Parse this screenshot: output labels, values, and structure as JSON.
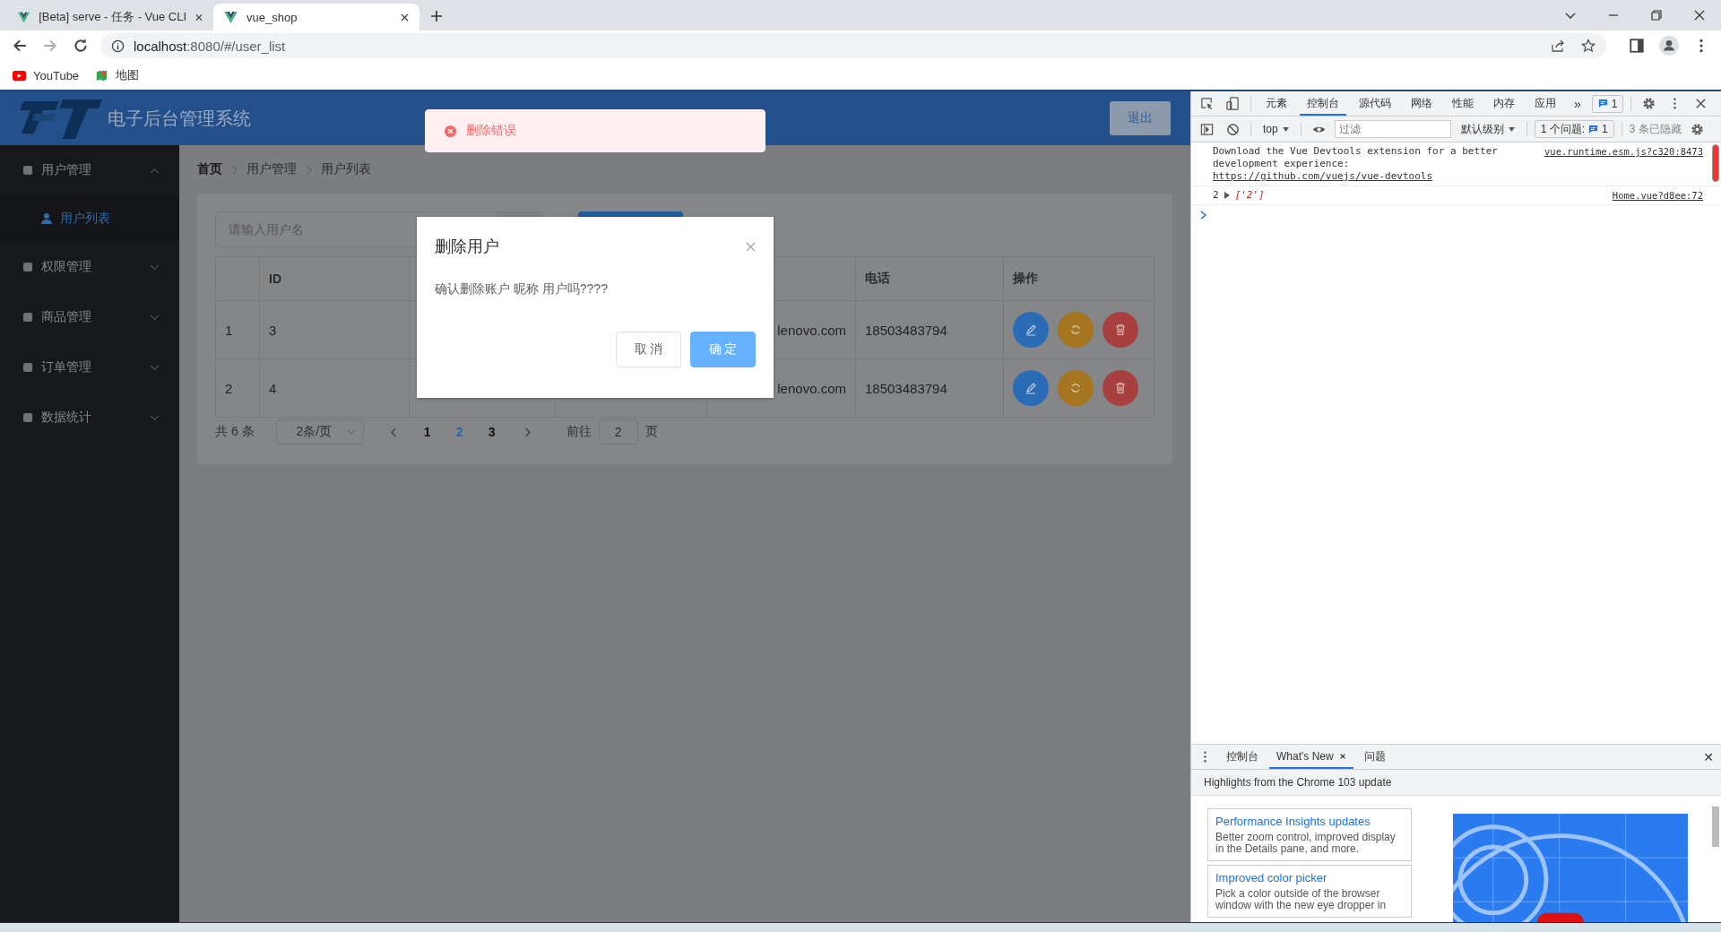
{
  "browser": {
    "tabs": [
      {
        "title": "[Beta] serve - 任务 - Vue CLI",
        "selected": false
      },
      {
        "title": "vue_shop",
        "selected": true
      }
    ],
    "address": {
      "host": "localhost",
      "rest": ":8080/#/user_list"
    },
    "bookmarks": [
      "YouTube",
      "地图"
    ]
  },
  "app": {
    "title": "电子后台管理系统",
    "logout": "退出",
    "sidebar": [
      {
        "label": "用户管理",
        "expanded": true,
        "children": [
          {
            "label": "用户列表",
            "selected": true
          }
        ]
      },
      {
        "label": "权限管理",
        "expanded": false
      },
      {
        "label": "商品管理",
        "expanded": false
      },
      {
        "label": "订单管理",
        "expanded": false
      },
      {
        "label": "数据统计",
        "expanded": false
      }
    ],
    "breadcrumb": [
      "首页",
      "用户管理",
      "用户列表"
    ],
    "search": {
      "placeholder": "请输入用户名"
    },
    "table": {
      "columns": {
        "id": "ID",
        "phone": "电话",
        "actions": "操作"
      },
      "rows": [
        {
          "index": "1",
          "id": "3",
          "email": "lenovo.com",
          "phone": "18503483794"
        },
        {
          "index": "2",
          "id": "4",
          "email": "lenovo.com",
          "phone": "18503483794"
        }
      ]
    },
    "pagination": {
      "total": "共 6 条",
      "page_size": "2条/页",
      "pages": [
        {
          "label": "1",
          "selected": false
        },
        {
          "label": "2",
          "selected": true
        },
        {
          "label": "3",
          "selected": false
        }
      ],
      "goto_label": "前往",
      "goto_value": "2",
      "goto_suffix": "页"
    },
    "message": {
      "kind": "error",
      "text": "删除错误"
    },
    "dialog": {
      "title": "删除用户",
      "body": "确认删除账户 昵称 用户吗????",
      "cancel": "取 消",
      "confirm": "确 定"
    }
  },
  "devtools": {
    "tabs": [
      {
        "label": "元素",
        "selected": false
      },
      {
        "label": "控制台",
        "selected": true
      },
      {
        "label": "源代码",
        "selected": false
      },
      {
        "label": "网络",
        "selected": false
      },
      {
        "label": "性能",
        "selected": false
      },
      {
        "label": "内存",
        "selected": false
      },
      {
        "label": "应用",
        "selected": false
      }
    ],
    "more": "»",
    "issues_badge": "1",
    "context": "top",
    "filter": {
      "placeholder": "过滤"
    },
    "level": "默认级别",
    "issues_label": "1 个问题:",
    "issues_count": "1",
    "hidden": "3 条已隐藏",
    "messages": [
      {
        "text": "Download the Vue Devtools extension for a better development experience:",
        "link": "https://github.com/vuejs/vue-devtools",
        "source": "vue.runtime.esm.js?c320:8473"
      },
      {
        "count": "2",
        "value": "['2']",
        "source": "Home.vue?d8ee:72"
      }
    ],
    "drawer": {
      "tabs": [
        {
          "label": "控制台",
          "selected": false,
          "closable": false
        },
        {
          "label": "What's New",
          "selected": true,
          "closable": true
        },
        {
          "label": "问题",
          "selected": false,
          "closable": false
        }
      ],
      "close": "✕",
      "heading": "Highlights from the Chrome 103 update",
      "cards": [
        {
          "title": "Performance Insights updates",
          "body": "Better zoom control, improved display in the Details pane, and more."
        },
        {
          "title": "Improved color picker",
          "body": "Pick a color outside of the browser window with the new eye dropper in"
        }
      ]
    }
  }
}
